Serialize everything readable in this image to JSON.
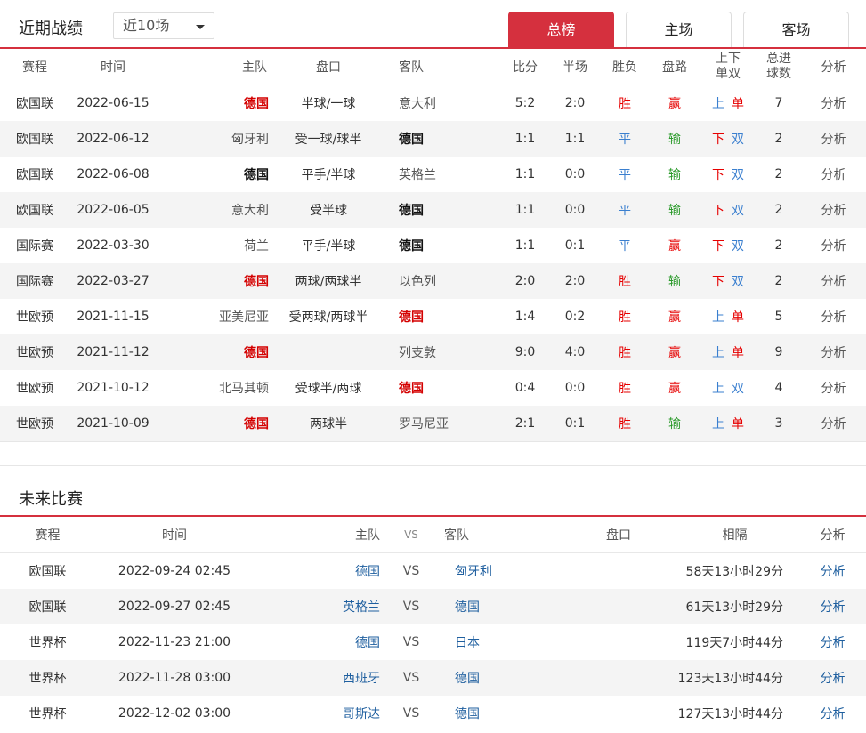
{
  "recent": {
    "title": "近期战绩",
    "dropdown_value": "近10场",
    "tabs": [
      {
        "label": "总榜",
        "active": true
      },
      {
        "label": "主场",
        "active": false
      },
      {
        "label": "客场",
        "active": false
      }
    ],
    "headers": {
      "league": "赛程",
      "time": "时间",
      "home": "主队",
      "handicap": "盘口",
      "away": "客队",
      "score": "比分",
      "half": "半场",
      "wl": "胜负",
      "ah": "盘路",
      "ou_line1": "上下",
      "ou_line2": "单双",
      "goals_line1": "总进",
      "goals_line2": "球数",
      "analysis": "分析"
    },
    "rows": [
      {
        "league": "欧国联",
        "time": "2022-06-15",
        "home": "德国",
        "home_style": "bold-red",
        "handicap": "半球/一球",
        "away": "意大利",
        "away_style": "muted",
        "score": "5:2",
        "half": "2:0",
        "wl": "胜",
        "wl_style": "win",
        "ah": "赢",
        "ah_style": "win",
        "ou": "上",
        "ou_style": "up",
        "oe": "单",
        "oe_style": "single",
        "goals": "7",
        "analysis": "分析"
      },
      {
        "league": "欧国联",
        "time": "2022-06-12",
        "home": "匈牙利",
        "home_style": "muted",
        "handicap": "受一球/球半",
        "away": "德国",
        "away_style": "bold-black",
        "score": "1:1",
        "half": "1:1",
        "wl": "平",
        "wl_style": "draw",
        "ah": "输",
        "ah_style": "lose",
        "ou": "下",
        "ou_style": "down",
        "oe": "双",
        "oe_style": "double",
        "goals": "2",
        "analysis": "分析"
      },
      {
        "league": "欧国联",
        "time": "2022-06-08",
        "home": "德国",
        "home_style": "bold-black",
        "handicap": "平手/半球",
        "away": "英格兰",
        "away_style": "muted",
        "score": "1:1",
        "half": "0:0",
        "wl": "平",
        "wl_style": "draw",
        "ah": "输",
        "ah_style": "lose",
        "ou": "下",
        "ou_style": "down",
        "oe": "双",
        "oe_style": "double",
        "goals": "2",
        "analysis": "分析"
      },
      {
        "league": "欧国联",
        "time": "2022-06-05",
        "home": "意大利",
        "home_style": "muted",
        "handicap": "受半球",
        "away": "德国",
        "away_style": "bold-black",
        "score": "1:1",
        "half": "0:0",
        "wl": "平",
        "wl_style": "draw",
        "ah": "输",
        "ah_style": "lose",
        "ou": "下",
        "ou_style": "down",
        "oe": "双",
        "oe_style": "double",
        "goals": "2",
        "analysis": "分析"
      },
      {
        "league": "国际赛",
        "time": "2022-03-30",
        "home": "荷兰",
        "home_style": "muted",
        "handicap": "平手/半球",
        "away": "德国",
        "away_style": "bold-black",
        "score": "1:1",
        "half": "0:1",
        "wl": "平",
        "wl_style": "draw",
        "ah": "赢",
        "ah_style": "win",
        "ou": "下",
        "ou_style": "down",
        "oe": "双",
        "oe_style": "double",
        "goals": "2",
        "analysis": "分析"
      },
      {
        "league": "国际赛",
        "time": "2022-03-27",
        "home": "德国",
        "home_style": "bold-red",
        "handicap": "两球/两球半",
        "away": "以色列",
        "away_style": "muted",
        "score": "2:0",
        "half": "2:0",
        "wl": "胜",
        "wl_style": "win",
        "ah": "输",
        "ah_style": "lose",
        "ou": "下",
        "ou_style": "down",
        "oe": "双",
        "oe_style": "double",
        "goals": "2",
        "analysis": "分析"
      },
      {
        "league": "世欧预",
        "time": "2021-11-15",
        "home": "亚美尼亚",
        "home_style": "muted",
        "handicap": "受两球/两球半",
        "away": "德国",
        "away_style": "bold-red",
        "score": "1:4",
        "half": "0:2",
        "wl": "胜",
        "wl_style": "win",
        "ah": "赢",
        "ah_style": "win",
        "ou": "上",
        "ou_style": "up",
        "oe": "单",
        "oe_style": "single",
        "goals": "5",
        "analysis": "分析"
      },
      {
        "league": "世欧预",
        "time": "2021-11-12",
        "home": "德国",
        "home_style": "bold-red",
        "handicap": "",
        "away": "列支敦",
        "away_style": "muted",
        "score": "9:0",
        "half": "4:0",
        "wl": "胜",
        "wl_style": "win",
        "ah": "赢",
        "ah_style": "win",
        "ou": "上",
        "ou_style": "up",
        "oe": "单",
        "oe_style": "single",
        "goals": "9",
        "analysis": "分析"
      },
      {
        "league": "世欧预",
        "time": "2021-10-12",
        "home": "北马其顿",
        "home_style": "muted",
        "handicap": "受球半/两球",
        "away": "德国",
        "away_style": "bold-red",
        "score": "0:4",
        "half": "0:0",
        "wl": "胜",
        "wl_style": "win",
        "ah": "赢",
        "ah_style": "win",
        "ou": "上",
        "ou_style": "up",
        "oe": "双",
        "oe_style": "double",
        "goals": "4",
        "analysis": "分析"
      },
      {
        "league": "世欧预",
        "time": "2021-10-09",
        "home": "德国",
        "home_style": "bold-red",
        "handicap": "两球半",
        "away": "罗马尼亚",
        "away_style": "muted",
        "score": "2:1",
        "half": "0:1",
        "wl": "胜",
        "wl_style": "win",
        "ah": "输",
        "ah_style": "lose",
        "ou": "上",
        "ou_style": "up",
        "oe": "单",
        "oe_style": "single",
        "goals": "3",
        "analysis": "分析"
      }
    ]
  },
  "upcoming": {
    "title": "未来比赛",
    "headers": {
      "league": "赛程",
      "time": "时间",
      "home": "主队",
      "vs": "VS",
      "away": "客队",
      "handicap": "盘口",
      "gap": "相隔",
      "analysis": "分析"
    },
    "rows": [
      {
        "league": "欧国联",
        "time": "2022-09-24 02:45",
        "home": "德国",
        "vs": "VS",
        "away": "匈牙利",
        "handicap": "",
        "gap": "58天13小时29分",
        "analysis": "分析"
      },
      {
        "league": "欧国联",
        "time": "2022-09-27 02:45",
        "home": "英格兰",
        "vs": "VS",
        "away": "德国",
        "handicap": "",
        "gap": "61天13小时29分",
        "analysis": "分析"
      },
      {
        "league": "世界杯",
        "time": "2022-11-23 21:00",
        "home": "德国",
        "vs": "VS",
        "away": "日本",
        "handicap": "",
        "gap": "119天7小时44分",
        "analysis": "分析"
      },
      {
        "league": "世界杯",
        "time": "2022-11-28 03:00",
        "home": "西班牙",
        "vs": "VS",
        "away": "德国",
        "handicap": "",
        "gap": "123天13小时44分",
        "analysis": "分析"
      },
      {
        "league": "世界杯",
        "time": "2022-12-02 03:00",
        "home": "哥斯达",
        "vs": "VS",
        "away": "德国",
        "handicap": "",
        "gap": "127天13小时44分",
        "analysis": "分析"
      }
    ]
  }
}
